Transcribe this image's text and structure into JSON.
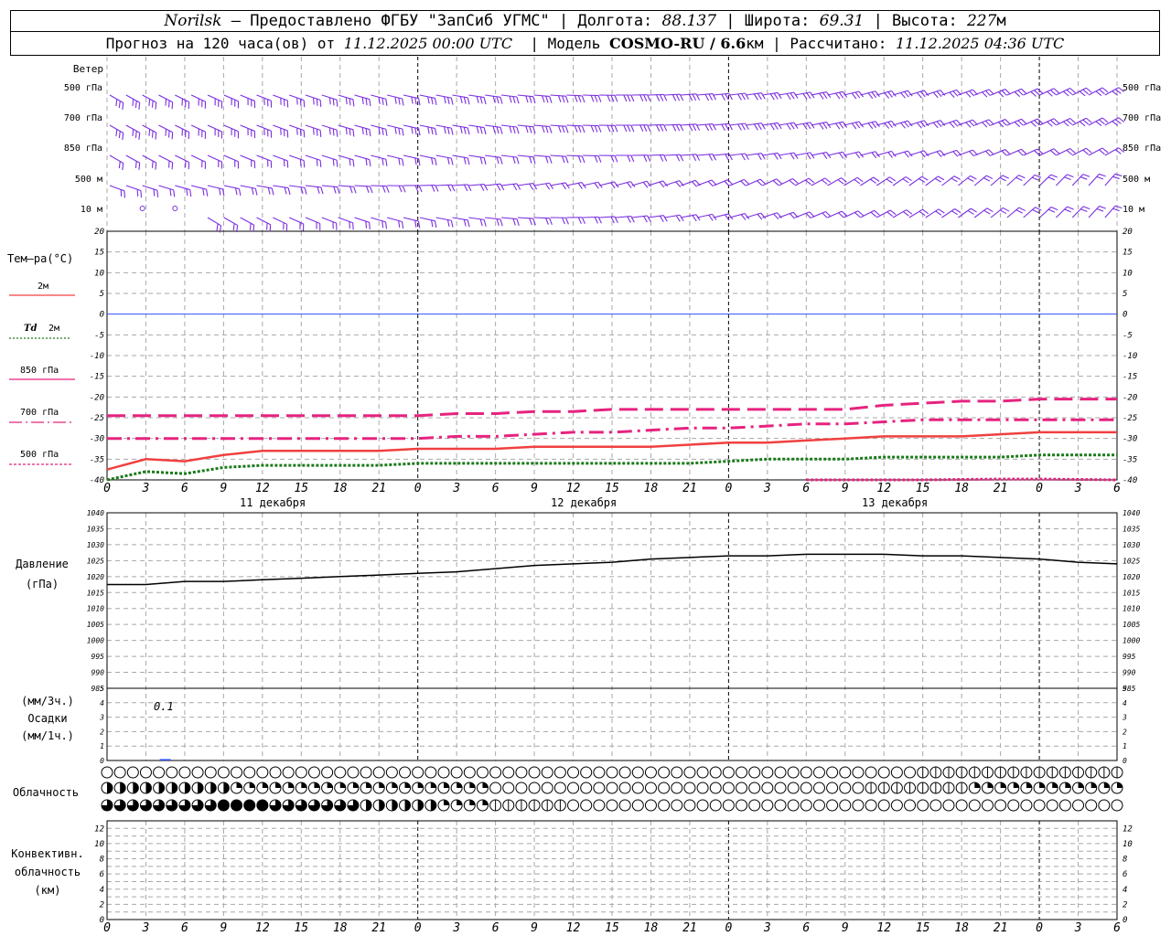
{
  "header": {
    "line1": {
      "station": "Norilsk",
      "provided_by": "– Предоставлено ФГБУ \"ЗапСиб УГМС\" | Долгота:",
      "lon": "88.137",
      "lat_label": "| Широта:",
      "lat": "69.31",
      "alt_label": "| Высота:",
      "alt": "227",
      "alt_unit": "м"
    },
    "line2": {
      "forecast_label": "Прогноз на 120 часа(ов) от",
      "start": "11.12.2025 00:00 UTC",
      "model_label": "| Модель",
      "model": "COSMO-RU / 6.6",
      "model_unit": "км",
      "calc_label": "| Рассчитано:",
      "calc_time": "11.12.2025 04:36 UTC"
    }
  },
  "colors": {
    "wind": "#7b2fe0",
    "t2m": "#f04040",
    "td2m": "#1a7a1a",
    "t850": "#e6237f",
    "t700": "#e6237f",
    "t500": "#e6237f",
    "zero": "#3050ff",
    "grid": "#a8a8a8",
    "pressure": "#000000"
  },
  "wind": {
    "title": "Ветер",
    "levels": [
      "500 гПа",
      "700 гПа",
      "850 гПа",
      "500 м",
      "10  м"
    ]
  },
  "temp": {
    "title": "Тем–ра(°С)",
    "legend": [
      {
        "label": "2м",
        "style": "solid"
      },
      {
        "label_it": "Td",
        "label": "2м",
        "style": "dotted"
      },
      {
        "label": "850 гПа",
        "style": "longdash"
      },
      {
        "label": "700 гПа",
        "style": "dashdot"
      },
      {
        "label": "500 гПа",
        "style": "dense"
      }
    ],
    "ticks": [
      "20",
      "15",
      "10",
      "5",
      "0",
      "-5",
      "-10",
      "-15",
      "-20",
      "-25",
      "-30",
      "-35",
      "-40"
    ]
  },
  "time_axis": {
    "hour_labels": [
      "0",
      "3",
      "6",
      "9",
      "12",
      "15",
      "18",
      "21",
      "0",
      "3",
      "6",
      "9",
      "12",
      "15",
      "18",
      "21",
      "0",
      "3",
      "6",
      "9",
      "12",
      "15",
      "18",
      "21",
      "0",
      "3",
      "6"
    ],
    "dates": [
      "11 декабря",
      "12 декабря",
      "13 декабря"
    ]
  },
  "pressure": {
    "title": "Давление",
    "unit": "(гПа)",
    "ticks": [
      "1040",
      "1035",
      "1030",
      "1025",
      "1020",
      "1015",
      "1010",
      "1005",
      "1000",
      "995",
      "990",
      "985"
    ]
  },
  "precip": {
    "unit3h": "(мм/3ч.)",
    "title": "Осадки",
    "unit1h": "(мм/1ч.)",
    "ticks": [
      "5",
      "4",
      "3",
      "2",
      "1",
      "0"
    ],
    "annotation": "0.1"
  },
  "clouds": {
    "title": "Облачность"
  },
  "convective": {
    "title": [
      "Конвективн.",
      "облачность",
      "(км)"
    ],
    "ticks": [
      "12",
      "10",
      "8",
      "6",
      "4",
      "2",
      "0"
    ]
  },
  "chart_data": [
    {
      "type": "line",
      "title": "Тем–ра(°С)",
      "x_unit": "hours from 11.12.2025 00:00 UTC",
      "ylim": [
        -40,
        20
      ],
      "x": [
        0,
        3,
        6,
        9,
        12,
        15,
        18,
        21,
        24,
        27,
        30,
        33,
        36,
        39,
        42,
        45,
        48,
        51,
        54,
        57,
        60,
        63,
        66,
        69,
        72,
        75,
        78
      ],
      "series": [
        {
          "name": "2м",
          "values": [
            -37.5,
            -35,
            -35.5,
            -34,
            -33,
            -33,
            -33,
            -33,
            -32.5,
            -32.5,
            -32.5,
            -32,
            -32,
            -32,
            -32,
            -31.5,
            -31,
            -31,
            -30.5,
            -30,
            -29.5,
            -29.5,
            -29.5,
            -29,
            -28.5,
            -28.5,
            -28.5
          ]
        },
        {
          "name": "Td 2м",
          "values": [
            -40,
            -38,
            -38.5,
            -37,
            -36.5,
            -36.5,
            -36.5,
            -36.5,
            -36,
            -36,
            -36,
            -36,
            -36,
            -36,
            -36,
            -36,
            -35.5,
            -35,
            -35,
            -35,
            -34.5,
            -34.5,
            -34.5,
            -34.5,
            -34,
            -34,
            -34
          ]
        },
        {
          "name": "850 гПа",
          "values": [
            -24.5,
            -24.5,
            -24.5,
            -24.5,
            -24.5,
            -24.5,
            -24.5,
            -24.5,
            -24.5,
            -24,
            -24,
            -23.5,
            -23.5,
            -23,
            -23,
            -23,
            -23,
            -23,
            -23,
            -23,
            -22,
            -21.5,
            -21,
            -21,
            -20.5,
            -20.5,
            -20.5
          ]
        },
        {
          "name": "700 гПа",
          "values": [
            -30,
            -30,
            -30,
            -30,
            -30,
            -30,
            -30,
            -30,
            -30,
            -29.5,
            -29.5,
            -29,
            -28.5,
            -28.5,
            -28,
            -27.5,
            -27.5,
            -27,
            -26.5,
            -26.5,
            -26,
            -25.5,
            -25.5,
            -25.5,
            -25.5,
            -25.5,
            -25.5
          ]
        },
        {
          "name": "500 гПа",
          "x": [
            54,
            57,
            60,
            63,
            66,
            69,
            72,
            75,
            78
          ],
          "values": [
            -40,
            -40,
            -40,
            -40,
            -39.9,
            -39.8,
            -39.8,
            -39.9,
            -40
          ]
        }
      ]
    },
    {
      "type": "line",
      "title": "Давление",
      "x_unit": "hours from 11.12.2025 00:00 UTC",
      "ylim": [
        985,
        1040
      ],
      "x": [
        0,
        3,
        6,
        9,
        12,
        15,
        18,
        21,
        24,
        27,
        30,
        33,
        36,
        39,
        42,
        45,
        48,
        51,
        54,
        57,
        60,
        63,
        66,
        69,
        72,
        75,
        78
      ],
      "series": [
        {
          "name": "Давление",
          "values": [
            1017.5,
            1017.5,
            1018.5,
            1018.5,
            1019,
            1019.5,
            1020,
            1020.5,
            1021,
            1021.5,
            1022.5,
            1023.5,
            1024,
            1024.5,
            1025.5,
            1026,
            1026.5,
            1026.5,
            1027,
            1027,
            1027,
            1026.5,
            1026.5,
            1026,
            1025.5,
            1024.5,
            1024
          ]
        }
      ]
    },
    {
      "type": "bar",
      "title": "Осадки",
      "x_unit": "hours from 11.12.2025 00:00 UTC",
      "ylim": [
        0,
        5
      ],
      "x": [
        4.5
      ],
      "values": [
        0.1
      ]
    }
  ]
}
